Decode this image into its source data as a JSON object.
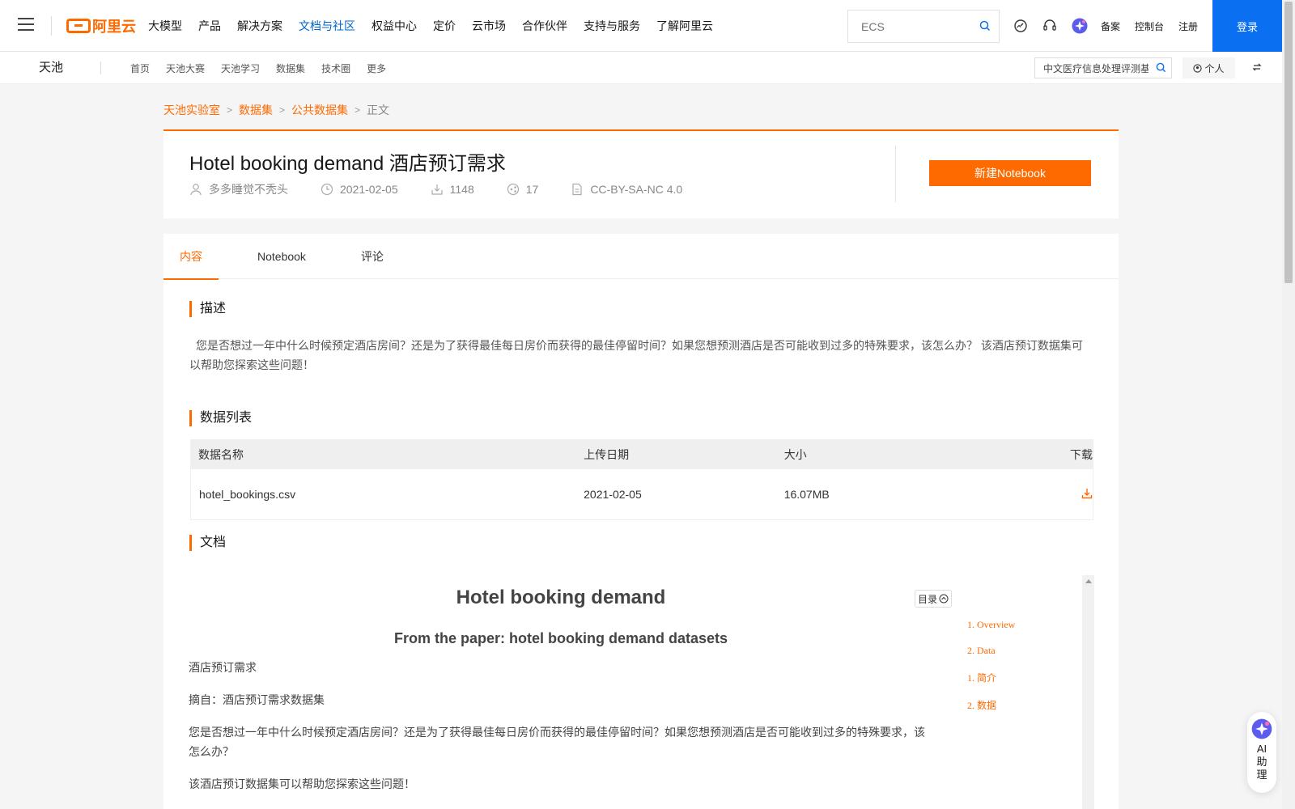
{
  "topbar": {
    "logo_text": "阿里云",
    "nav": [
      "大模型",
      "产品",
      "解决方案",
      "文档与社区",
      "权益中心",
      "定价",
      "云市场",
      "合作伙伴",
      "支持与服务",
      "了解阿里云"
    ],
    "active_nav": "文档与社区",
    "search_placeholder": "ECS",
    "links": [
      "备案",
      "控制台",
      "注册"
    ],
    "login": "登录",
    "brand_color": "#ff6a00",
    "accent_color": "#0b6ff2"
  },
  "subbar": {
    "brand": "天池",
    "nav": [
      "首页",
      "天池大赛",
      "天池学习",
      "数据集",
      "技术圈",
      "更多"
    ],
    "search_value": "中文医疗信息处理评测基",
    "personal": "个人"
  },
  "breadcrumb": [
    "天池实验室",
    "数据集",
    "公共数据集",
    "正文"
  ],
  "dataset": {
    "title_en": "Hotel booking demand",
    "title_cn": "酒店预订需求",
    "author": "多多睡觉不秃头",
    "date": "2021-02-05",
    "downloads": "1148",
    "shares": "17",
    "license": "CC-BY-SA-NC 4.0",
    "new_notebook": "新建Notebook"
  },
  "tabs": [
    "内容",
    "Notebook",
    "评论"
  ],
  "sections": {
    "desc_title": "描述",
    "desc_text": "您是否想过一年中什么时候预定酒店房间？还是为了获得最佳每日房价而获得的最佳停留时间？如果您想预测酒店是否可能收到过多的特殊要求，该怎么办？ 该酒店预订数据集可以帮助您探索这些问题！",
    "list_title": "数据列表",
    "doc_title": "文档"
  },
  "table": {
    "headers": [
      "数据名称",
      "上传日期",
      "大小",
      "下载"
    ],
    "rows": [
      {
        "name": "hotel_bookings.csv",
        "date": "2021-02-05",
        "size": "16.07MB"
      }
    ]
  },
  "doc": {
    "h1": "Hotel booking demand",
    "h2": "From the paper: hotel booking demand datasets",
    "p1": "酒店预订需求",
    "p2": "摘自：酒店预订需求数据集",
    "p3": "您是否想过一年中什么时候预定酒店房间？还是为了获得最佳每日房价而获得的最佳停留时间？如果您想预测酒店是否可能收到过多的特殊要求，该怎么办？",
    "p4": "该酒店预订数据集可以帮助您探索这些问题！",
    "toc_label": "目录",
    "toc": [
      "1. Overview",
      "2. Data",
      "1. 简介",
      "2. 数据"
    ]
  },
  "ai": {
    "label": "AI助理"
  }
}
